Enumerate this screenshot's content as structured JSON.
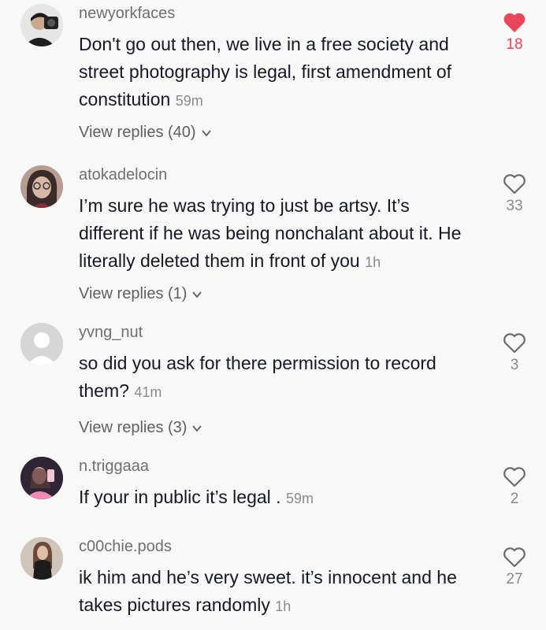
{
  "comments": [
    {
      "username": "newyorkfaces",
      "text": "Don't go out then, we live in a free society and street photography is legal, first amendment of constitution",
      "time": "59m",
      "replies": "View replies (40)",
      "likes": "18",
      "liked": true,
      "avatar": "camera-man-avatar"
    },
    {
      "username": "atokadelocin",
      "text": "I’m sure he was trying to just be artsy. It’s different if he was being nonchalant about it. He literally deleted them in front of you",
      "time": "1h",
      "replies": "View replies (1)",
      "likes": "33",
      "liked": false,
      "avatar": "woman-glasses-avatar"
    },
    {
      "username": "yvng_nut",
      "text": "so did you ask for there permission to record them?",
      "time": "41m",
      "replies": "View replies (3)",
      "likes": "3",
      "liked": false,
      "avatar": "default-avatar"
    },
    {
      "username": "n.triggaaa",
      "text": "If your in public it’s legal .",
      "time": "59m",
      "replies": "",
      "likes": "2",
      "liked": false,
      "avatar": "pink-selfie-avatar"
    },
    {
      "username": "c00chie.pods",
      "text": "ik him and he’s very sweet. it’s innocent and he takes pictures randomly",
      "time": "1h",
      "replies": "",
      "likes": "27",
      "liked": false,
      "avatar": "mirror-selfie-avatar"
    }
  ],
  "colors": {
    "background": "#f8f8f8",
    "liked": "#e8465b",
    "muted": "#8a8a8a"
  }
}
